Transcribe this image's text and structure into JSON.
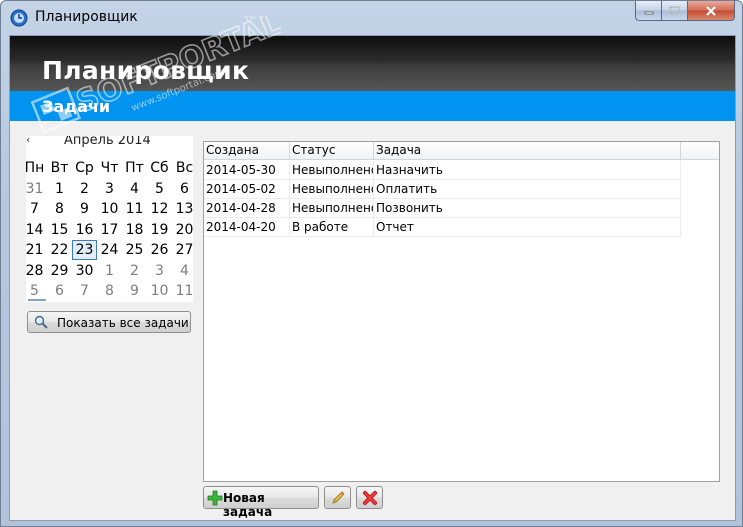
{
  "window": {
    "title": "Планировщик"
  },
  "banner": {
    "title": "Планировщик",
    "section": "Задачи"
  },
  "calendar": {
    "month_label": "Апрель 2014",
    "prev_label": "‹",
    "weekdays": [
      "Пн",
      "Вт",
      "Ср",
      "Чт",
      "Пт",
      "Сб",
      "Вс"
    ],
    "weeks": [
      [
        {
          "d": "31",
          "dim": true
        },
        {
          "d": "1"
        },
        {
          "d": "2"
        },
        {
          "d": "3"
        },
        {
          "d": "4"
        },
        {
          "d": "5"
        },
        {
          "d": "6"
        }
      ],
      [
        {
          "d": "7"
        },
        {
          "d": "8"
        },
        {
          "d": "9"
        },
        {
          "d": "10"
        },
        {
          "d": "11"
        },
        {
          "d": "12"
        },
        {
          "d": "13"
        }
      ],
      [
        {
          "d": "14"
        },
        {
          "d": "15"
        },
        {
          "d": "16"
        },
        {
          "d": "17"
        },
        {
          "d": "18"
        },
        {
          "d": "19"
        },
        {
          "d": "20"
        }
      ],
      [
        {
          "d": "21"
        },
        {
          "d": "22"
        },
        {
          "d": "23",
          "today": true
        },
        {
          "d": "24"
        },
        {
          "d": "25"
        },
        {
          "d": "26"
        },
        {
          "d": "27"
        }
      ],
      [
        {
          "d": "28"
        },
        {
          "d": "29"
        },
        {
          "d": "30"
        },
        {
          "d": "1",
          "dim": true
        },
        {
          "d": "2",
          "dim": true
        },
        {
          "d": "3",
          "dim": true
        },
        {
          "d": "4",
          "dim": true
        }
      ],
      [
        {
          "d": "5",
          "dim": true
        },
        {
          "d": "6",
          "dim": true
        },
        {
          "d": "7",
          "dim": true
        },
        {
          "d": "8",
          "dim": true
        },
        {
          "d": "9",
          "dim": true
        },
        {
          "d": "10",
          "dim": true
        },
        {
          "d": "11",
          "dim": true
        }
      ]
    ]
  },
  "show_all_button": {
    "label": "Показать все задачи",
    "icon": "magnifier-icon"
  },
  "task_table": {
    "columns": [
      "Создана",
      "Статус",
      "Задача"
    ],
    "rows": [
      [
        "2014-05-30",
        "Невыполнено",
        "Назначить"
      ],
      [
        "2014-05-02",
        "Невыполнено",
        "Оплатить"
      ],
      [
        "2014-04-28",
        "Невыполнено",
        "Позвонить"
      ],
      [
        "2014-04-20",
        "В работе",
        "Отчет"
      ]
    ]
  },
  "toolbar": {
    "new_task_label": "Новая задача",
    "new_task_icon": "green-plus-icon",
    "edit_icon": "pencil-icon",
    "delete_icon": "red-x-icon"
  },
  "watermark": {
    "brand": "SOFTPORTAL",
    "url": "www.softportal.com",
    "tm": "TM"
  },
  "colors": {
    "accent_blue": "#0093f0",
    "banner_dark": "#1e1e1e",
    "window_frame": "#b6c8de"
  }
}
